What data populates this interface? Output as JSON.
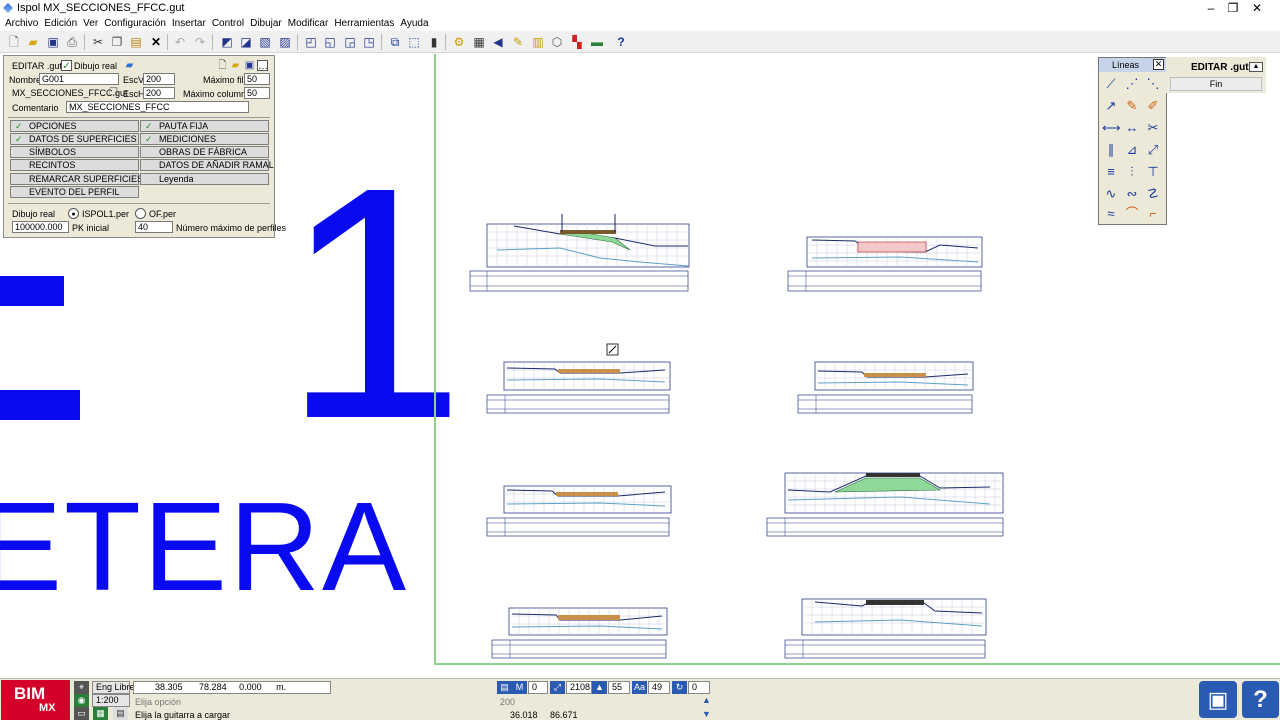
{
  "window": {
    "title": "Ispol  MX_SECCIONES_FFCC.gut",
    "controls": {
      "minimize": "–",
      "restore": "❐",
      "close": "✕"
    }
  },
  "menu": [
    "Archivo",
    "Edición",
    "Ver",
    "Configuración",
    "Insertar",
    "Control",
    "Dibujar",
    "Modificar",
    "Herramientas",
    "Ayuda"
  ],
  "panel": {
    "file_label": "EDITAR .gut",
    "dibujo_real_check": "Dibujo real",
    "nombre_label": "Nombre:",
    "nombre_value": "G001",
    "escv_label": "EscV",
    "escv_value": "200",
    "max_filas_label": "Máximo filas:",
    "max_filas_value": "50",
    "file_name": "MX_SECCIONES_FFCC.gut",
    "esch_label": "EscH",
    "esch_value": "200",
    "max_columnas_label": "Máximo columnas:",
    "max_columnas_value": "50",
    "comentario_label": "Comentario",
    "comentario_value": "MX_SECCIONES_FFCC",
    "buttons": {
      "opciones": "OPCIONES",
      "pauta_fija": "PAUTA FIJA",
      "datos_superficies": "DATOS DE SUPERFICIES",
      "mediciones": "MEDICIONES",
      "simbolos": "SÍMBOLOS",
      "obras_fabrica": "OBRAS DE FÁBRICA",
      "recintos": "RECINTOS",
      "datos_ramal": "DATOS DE AÑADIR RAMAL",
      "remarcar": "REMARCAR SUPERFICIES",
      "leyenda": "Leyenda",
      "evento": "EVENTO DEL PERFIL"
    },
    "dibujo_real_label": "Dibujo real",
    "radio_ispol": "ISPOL1.per",
    "radio_of": "OF.per",
    "pk_value": "100000.000",
    "pk_label": "PK inicial",
    "num_perfiles_value": "40",
    "num_perfiles_label": "Número máximo de perfiles"
  },
  "background_text": {
    "big_one": "1",
    "etera": "ETERA"
  },
  "lineas_palette": {
    "title": "Líneas",
    "close": "✕"
  },
  "editar": {
    "title": "EDITAR .gut",
    "fin": "Fin"
  },
  "status": {
    "eng_libre": "Eng Libre",
    "scale": "1:200",
    "coord_x": "38.305",
    "coord_y": "78.284",
    "coord_z": "0.000",
    "units": "m.",
    "prompt1": "Elija opción",
    "prompt2": "Elija la guitarra a cargar",
    "value_200": "200",
    "coord2_x": "36.018",
    "coord2_y": "86.671",
    "f_m": "0",
    "f_line": "2108",
    "f_a": "55",
    "f_aa": "49",
    "f_last": "0"
  },
  "logo": {
    "main": "BIM",
    "sub": "MX"
  },
  "colors": {
    "accent_blue": "#0a0af0",
    "frame_green": "#8ed18e",
    "logo_red": "#d4002a"
  }
}
